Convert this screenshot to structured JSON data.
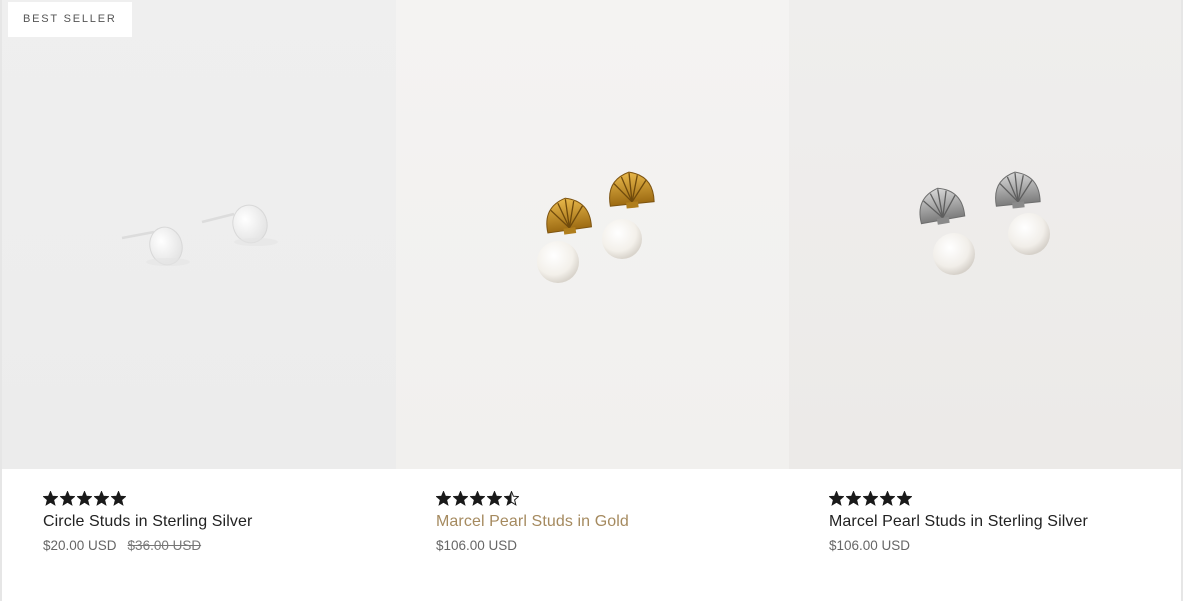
{
  "badge": {
    "label": "BEST SELLER"
  },
  "products": [
    {
      "name": "Circle Studs in Sterling Silver",
      "price": "$20.00 USD",
      "compare_price": "$36.00 USD",
      "rating": 5,
      "rating_max": 5,
      "image": "silver-circle-stud-earrings"
    },
    {
      "name": "Marcel Pearl Studs in Gold",
      "price": "$106.00 USD",
      "rating": 4.5,
      "rating_max": 5,
      "image": "gold-shell-pearl-drop-earrings"
    },
    {
      "name": "Marcel Pearl Studs in Sterling Silver",
      "price": "$106.00 USD",
      "rating": 5,
      "rating_max": 5,
      "image": "silver-shell-pearl-drop-earrings"
    }
  ],
  "colors": {
    "title_hover": "#a58a5f",
    "star": "#1a1a1a",
    "gold": "#c9952a",
    "silver": "#9a9a9a",
    "pearl": "#f5f3ef"
  }
}
